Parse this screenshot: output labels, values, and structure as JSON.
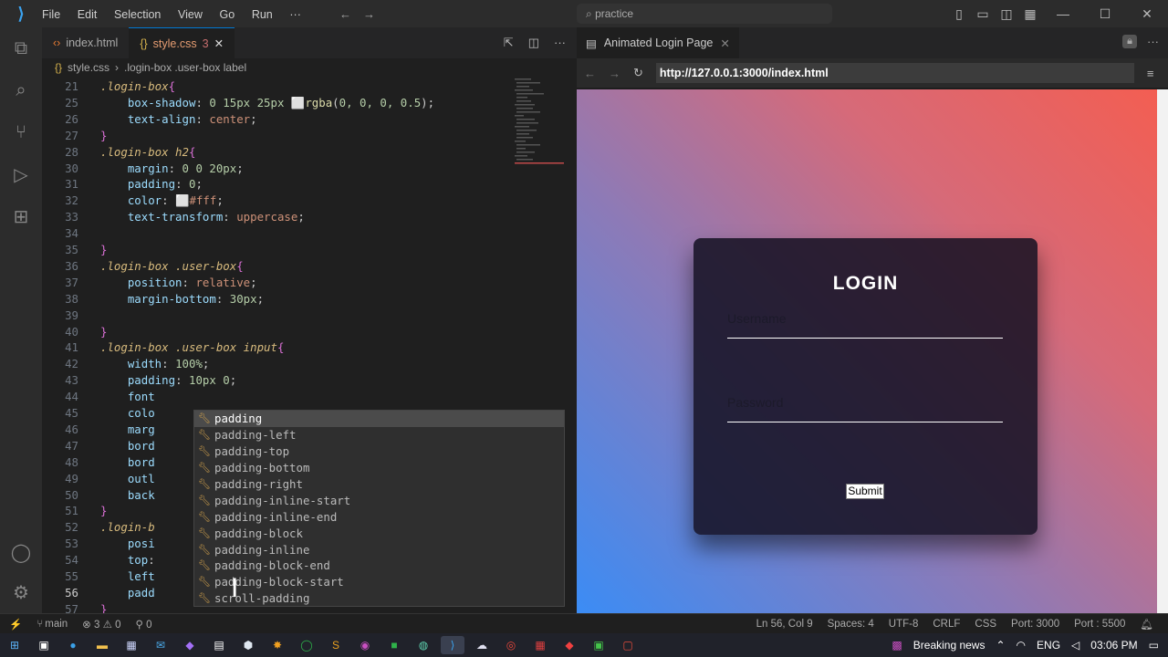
{
  "menu": [
    "File",
    "Edit",
    "Selection",
    "View",
    "Go",
    "Run",
    "···"
  ],
  "search_placeholder": "practice",
  "editor": {
    "tabs": [
      {
        "label": "index.html"
      },
      {
        "label": "style.css",
        "badge": "3"
      }
    ],
    "breadcrumb": {
      "file": "style.css",
      "path": ".login-box .user-box label"
    },
    "lines": [
      {
        "n": "21",
        "html": "<span class='sel'>.login-box</span><span class='br'>{</span>"
      },
      {
        "n": "25",
        "html": "    <span class='prop'>box-shadow</span>: <span class='num'>0 15px 25px</span> ⬜<span class='fn'>rgba</span>(<span class='num'>0, 0, 0, 0.5</span>);"
      },
      {
        "n": "26",
        "html": "    <span class='prop'>text-align</span>: <span class='kw'>center</span>;"
      },
      {
        "n": "27",
        "html": "<span class='br'>}</span>"
      },
      {
        "n": "28",
        "html": "<span class='sel'>.login-box h2</span><span class='br'>{</span>"
      },
      {
        "n": "30",
        "html": "    <span class='prop'>margin</span>: <span class='num'>0 0 20px</span>;"
      },
      {
        "n": "31",
        "html": "    <span class='prop'>padding</span>: <span class='num'>0</span>;"
      },
      {
        "n": "32",
        "html": "    <span class='prop'>color</span>: ⬜<span class='kw'>#fff</span>;"
      },
      {
        "n": "33",
        "html": "    <span class='prop'>text-transform</span>: <span class='kw'>uppercase</span>;"
      },
      {
        "n": "34",
        "html": ""
      },
      {
        "n": "35",
        "html": "<span class='br'>}</span>"
      },
      {
        "n": "36",
        "html": "<span class='sel'>.login-box .user-box</span><span class='br'>{</span>"
      },
      {
        "n": "37",
        "html": "    <span class='prop'>position</span>: <span class='kw'>relative</span>;"
      },
      {
        "n": "38",
        "html": "    <span class='prop'>margin-bottom</span>: <span class='num'>30px</span>;"
      },
      {
        "n": "39",
        "html": ""
      },
      {
        "n": "40",
        "html": "<span class='br'>}</span>"
      },
      {
        "n": "41",
        "html": "<span class='sel'>.login-box .user-box input</span><span class='br'>{</span>"
      },
      {
        "n": "42",
        "html": "    <span class='prop'>width</span>: <span class='num'>100%</span>;"
      },
      {
        "n": "43",
        "html": "    <span class='prop'>padding</span>: <span class='num'>10px 0</span>;"
      },
      {
        "n": "44",
        "html": "    <span class='prop'>font</span>"
      },
      {
        "n": "45",
        "html": "    <span class='prop'>colo</span>"
      },
      {
        "n": "46",
        "html": "    <span class='prop'>marg</span>"
      },
      {
        "n": "47",
        "html": "    <span class='prop'>bord</span>"
      },
      {
        "n": "48",
        "html": "    <span class='prop'>bord</span>"
      },
      {
        "n": "49",
        "html": "    <span class='prop'>outl</span>"
      },
      {
        "n": "50",
        "html": "    <span class='prop'>back</span>"
      },
      {
        "n": "51",
        "html": "<span class='br'>}</span>"
      },
      {
        "n": "52",
        "html": "<span class='sel'>.login-b</span>"
      },
      {
        "n": "53",
        "html": "    <span class='prop'>posi</span>"
      },
      {
        "n": "54",
        "html": "    <span class='prop'>top</span>:"
      },
      {
        "n": "55",
        "html": "    <span class='prop'>left</span>"
      },
      {
        "n": "56",
        "html": "    <span class='prop'>padd</span>"
      },
      {
        "n": "57",
        "html": "<span class='br'>}</span>"
      }
    ],
    "suggestions": [
      "padding",
      "padding-left",
      "padding-top",
      "padding-bottom",
      "padding-right",
      "padding-inline-start",
      "padding-inline-end",
      "padding-block",
      "padding-inline",
      "padding-block-end",
      "padding-block-start",
      "scroll-padding"
    ]
  },
  "preview": {
    "tab_title": "Animated Login Page",
    "url": "http://127.0.0.1:3000/index.html",
    "login": {
      "title": "LOGIN",
      "username_label": "Username",
      "password_label": "Password",
      "submit_label": "Submit"
    }
  },
  "status": {
    "branch": "main",
    "errors": "⊗ 3 ⚠ 0",
    "ports": "⚲ 0",
    "position": "Ln 56, Col 9",
    "spaces": "Spaces: 4",
    "encoding": "UTF-8",
    "eol": "CRLF",
    "lang": "CSS",
    "port": "Port: 3000",
    "port2": "Port : 5500"
  },
  "taskbar": {
    "news": "Breaking news",
    "lang": "ENG",
    "time": "03:06 PM"
  }
}
